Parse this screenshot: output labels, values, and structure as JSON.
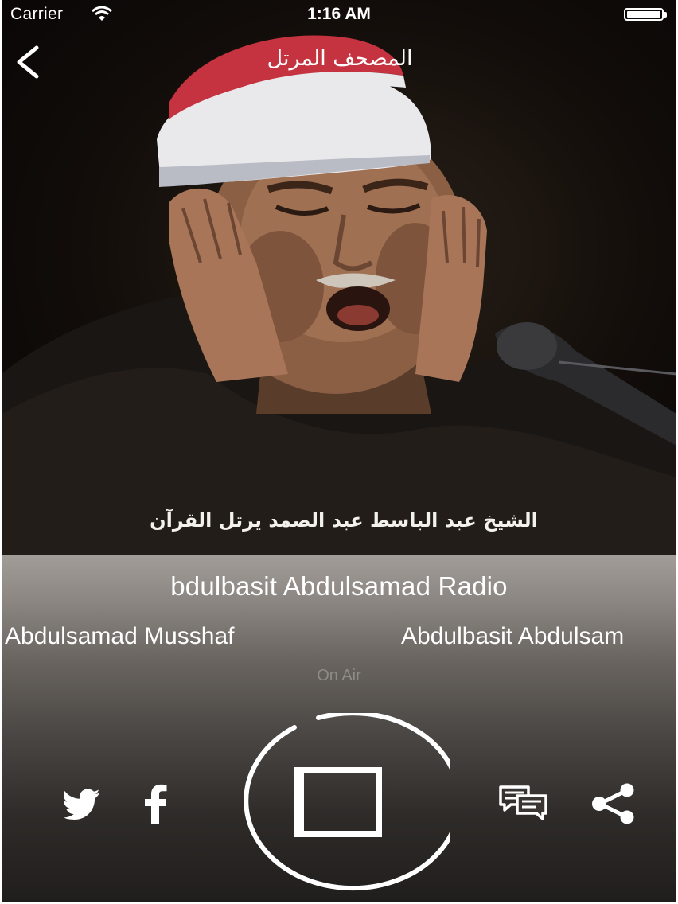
{
  "status_bar": {
    "carrier": "Carrier",
    "time": "1:16 AM"
  },
  "nav": {
    "title": "المصحف المرتل",
    "back_icon": "chevron-left-icon"
  },
  "hero": {
    "caption": "الشيخ عبد الباسط عبد الصمد يرتل القرآن"
  },
  "player": {
    "station_title": "bdulbasit Abdulsamad Radio",
    "marquee": [
      "Abdulsamad Musshaf",
      "Abdulbasit Abdulsam"
    ],
    "status": "On Air",
    "controls": {
      "twitter_icon": "twitter-icon",
      "facebook_icon": "facebook-icon",
      "stop_icon": "stop-icon",
      "comments_icon": "comments-icon",
      "share_icon": "share-icon"
    }
  },
  "colors": {
    "panel_top": "#a29d98",
    "panel_bottom": "#201e1c",
    "foreground": "#ffffff",
    "on_air": "#8f8b87",
    "cap_red": "#c4333f",
    "turban_white": "#e9e9ec"
  }
}
